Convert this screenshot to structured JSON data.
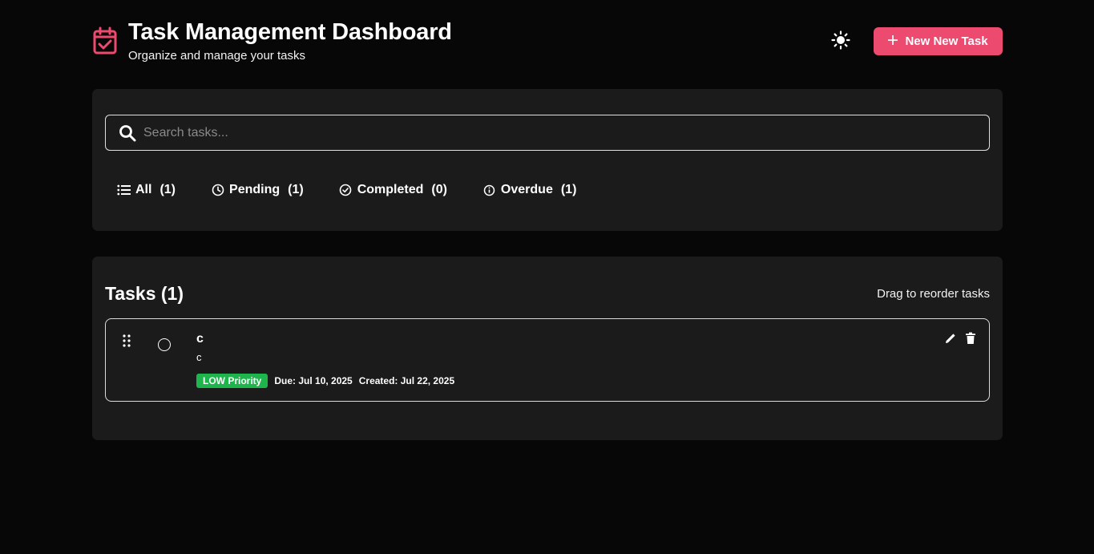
{
  "header": {
    "title": "Task Management Dashboard",
    "subtitle": "Organize and manage your tasks",
    "new_task_label": "New New Task",
    "app_icon": "calendar-check-icon",
    "theme_icon": "sun-icon"
  },
  "search": {
    "placeholder": "Search tasks...",
    "value": ""
  },
  "filters": [
    {
      "label": "All",
      "count": "(1)",
      "icon": "list-icon"
    },
    {
      "label": "Pending",
      "count": "(1)",
      "icon": "clock-icon"
    },
    {
      "label": "Completed",
      "count": "(0)",
      "icon": "check-circle-icon"
    },
    {
      "label": "Overdue",
      "count": "(1)",
      "icon": "info-icon"
    }
  ],
  "tasks_section": {
    "title": "Tasks (1)",
    "hint": "Drag to reorder tasks"
  },
  "tasks": [
    {
      "title": "c",
      "description": "c",
      "priority": "LOW Priority",
      "due": "Due: Jul 10, 2025",
      "created": "Created: Jul 22, 2025"
    }
  ],
  "colors": {
    "accent": "#ec4a6e",
    "priority_low": "#1fb54d",
    "background": "#070707",
    "panel": "#1b1b1b"
  }
}
